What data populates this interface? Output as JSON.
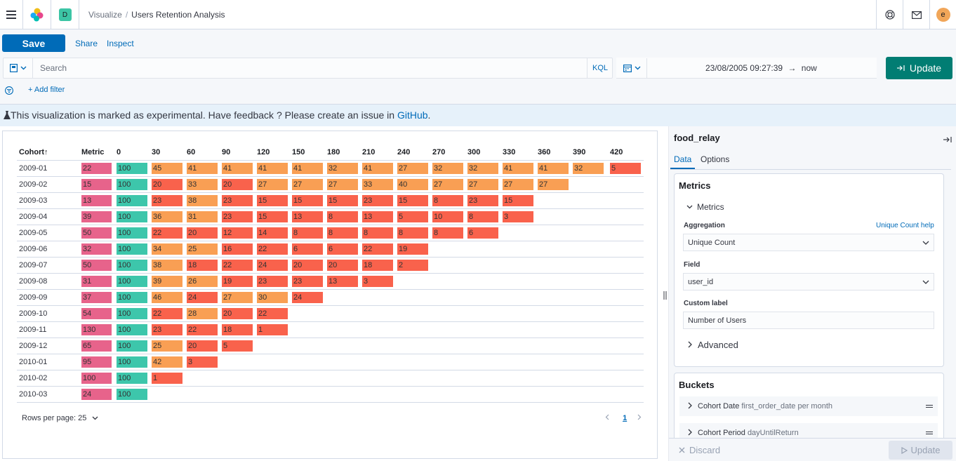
{
  "colors": {
    "metric": "#e7638b",
    "zero": "#3dc6ab",
    "orange": "#f99f54",
    "red": "#f9624c",
    "accent": "#006bb8",
    "update_green": "#017d73"
  },
  "header": {
    "space_letter": "D",
    "breadcrumb_root": "Visualize",
    "breadcrumb_separator": "/",
    "breadcrumb_current": "Users Retention Analysis",
    "avatar_letter": "e",
    "icons": [
      "menu-icon",
      "elastic-logo-icon",
      "help-icon",
      "mail-icon"
    ]
  },
  "toolbar": {
    "save_label": "Save",
    "share_label": "Share",
    "inspect_label": "Inspect",
    "search_placeholder": "Search",
    "kql_label": "KQL",
    "date_start": "23/08/2005 09:27:39",
    "date_arrow": "→",
    "date_end": "now",
    "update_label": "Update",
    "add_filter_label": "+ Add filter"
  },
  "callout": {
    "text": "This visualization is marked as experimental. Have feedback ? Please create an issue in ",
    "link": "GitHub",
    "end": "."
  },
  "table": {
    "columns": [
      "Cohort",
      "Metric",
      "0",
      "30",
      "60",
      "90",
      "120",
      "150",
      "180",
      "210",
      "240",
      "270",
      "300",
      "330",
      "360",
      "390",
      "420"
    ],
    "sort_arrow": "↑",
    "rows": [
      {
        "cohort": "2009-01",
        "metric": "22",
        "values": [
          "100",
          "45",
          "41",
          "41",
          "41",
          "41",
          "32",
          "41",
          "27",
          "32",
          "32",
          "41",
          "41",
          "32",
          "5"
        ]
      },
      {
        "cohort": "2009-02",
        "metric": "15",
        "values": [
          "100",
          "20",
          "33",
          "20",
          "27",
          "27",
          "27",
          "33",
          "40",
          "27",
          "27",
          "27",
          "27"
        ]
      },
      {
        "cohort": "2009-03",
        "metric": "13",
        "values": [
          "100",
          "23",
          "38",
          "23",
          "15",
          "15",
          "15",
          "23",
          "15",
          "8",
          "23",
          "15"
        ]
      },
      {
        "cohort": "2009-04",
        "metric": "39",
        "values": [
          "100",
          "36",
          "31",
          "23",
          "15",
          "13",
          "8",
          "13",
          "5",
          "10",
          "8",
          "3"
        ]
      },
      {
        "cohort": "2009-05",
        "metric": "50",
        "values": [
          "100",
          "22",
          "20",
          "12",
          "14",
          "8",
          "8",
          "8",
          "8",
          "8",
          "6"
        ]
      },
      {
        "cohort": "2009-06",
        "metric": "32",
        "values": [
          "100",
          "34",
          "25",
          "16",
          "22",
          "6",
          "6",
          "22",
          "19"
        ]
      },
      {
        "cohort": "2009-07",
        "metric": "50",
        "values": [
          "100",
          "38",
          "18",
          "22",
          "24",
          "20",
          "20",
          "18",
          "2"
        ]
      },
      {
        "cohort": "2009-08",
        "metric": "31",
        "values": [
          "100",
          "39",
          "26",
          "19",
          "23",
          "23",
          "13",
          "3"
        ]
      },
      {
        "cohort": "2009-09",
        "metric": "37",
        "values": [
          "100",
          "46",
          "24",
          "27",
          "30",
          "24"
        ]
      },
      {
        "cohort": "2009-10",
        "metric": "54",
        "values": [
          "100",
          "22",
          "28",
          "20",
          "22"
        ]
      },
      {
        "cohort": "2009-11",
        "metric": "130",
        "values": [
          "100",
          "23",
          "22",
          "18",
          "1"
        ]
      },
      {
        "cohort": "2009-12",
        "metric": "65",
        "values": [
          "100",
          "25",
          "20",
          "5"
        ]
      },
      {
        "cohort": "2010-01",
        "metric": "95",
        "values": [
          "100",
          "42",
          "3"
        ]
      },
      {
        "cohort": "2010-02",
        "metric": "100",
        "values": [
          "100",
          "1"
        ]
      },
      {
        "cohort": "2010-03",
        "metric": "24",
        "values": [
          "100"
        ]
      }
    ],
    "rows_per_page_label": "Rows per page: 25",
    "current_page": "1"
  },
  "editor": {
    "index_name": "food_relay",
    "tabs": [
      "Data",
      "Options"
    ],
    "metrics_title": "Metrics",
    "metrics_toggle": "Metrics",
    "aggregation_label": "Aggregation",
    "aggregation_help": "Unique Count help",
    "aggregation_value": "Unique Count",
    "field_label": "Field",
    "field_value": "user_id",
    "custom_label_label": "Custom label",
    "custom_label_value": "Number of Users",
    "advanced_label": "Advanced",
    "buckets_title": "Buckets",
    "bucket1_name": "Cohort Date",
    "bucket1_desc": "first_order_date per month",
    "bucket2_name": "Cohort Period",
    "bucket2_desc": "dayUntilReturn",
    "discard_label": "Discard",
    "update_label": "Update"
  }
}
